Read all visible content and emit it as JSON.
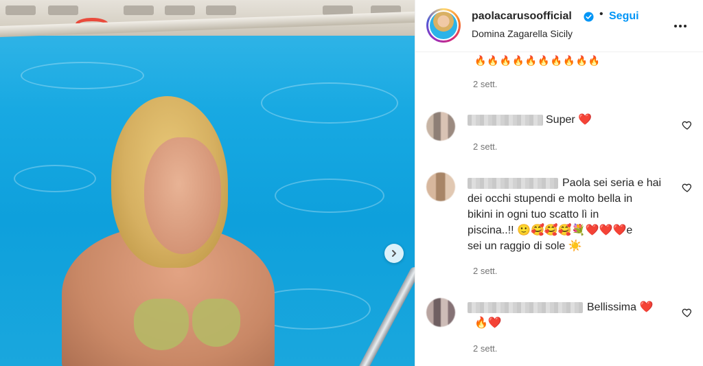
{
  "post": {
    "image_alt": "Woman in green bikini at the edge of a swimming pool"
  },
  "header": {
    "username": "paolacarusoofficial",
    "separator": "•",
    "follow_label": "Segui",
    "location": "Domina Zagarella Sicily",
    "verified": true
  },
  "comments": [
    {
      "text": "🔥🔥🔥🔥🔥🔥🔥🔥🔥🔥",
      "time": "2 sett."
    },
    {
      "username_blurred": true,
      "text": "Super ❤️",
      "time": "2 sett."
    },
    {
      "username_blurred": true,
      "lines": [
        "Paola sei seria e hai",
        "dei occhi stupendi e molto bella in",
        "bikini in ogni tuo scatto lì in",
        "piscina..!! 🙂🥰🥰🥰💐❤️❤️❤️e",
        "sei un raggio di sole ☀️"
      ],
      "time": "2 sett."
    },
    {
      "username_blurred": true,
      "lines": [
        "Bellissima ❤️",
        "🔥❤️"
      ],
      "time": "2 sett."
    }
  ],
  "colors": {
    "follow": "#0095f6",
    "verified": "#0095f6",
    "time": "#737373",
    "text": "#262626"
  }
}
